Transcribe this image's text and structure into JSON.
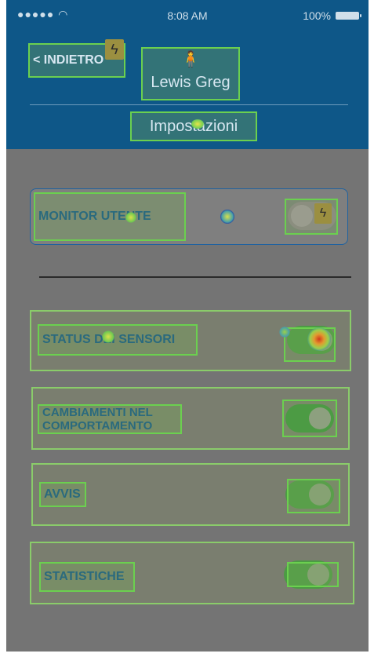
{
  "status_bar": {
    "signal": "●●●●● ",
    "wifi": "wifi-icon",
    "time": "8:08 AM",
    "battery": "100%"
  },
  "header": {
    "back_label": "< INDIETRO",
    "user_name": "Lewis Greg",
    "title": "Impostazioni"
  },
  "monitor": {
    "label": "MONITOR UTENTE",
    "enabled": false
  },
  "settings": [
    {
      "label": "STATUS DEI SENSORI",
      "enabled": true
    },
    {
      "label": "CAMBIAMENTI NEL COMPORTAMENTO",
      "enabled": true
    },
    {
      "label": "AVVIS",
      "enabled": true
    },
    {
      "label": "STATISTICHE",
      "enabled": true
    }
  ],
  "colors": {
    "header_bg": "#0e5788",
    "page_bg": "#747474",
    "highlight": "#6bd04f"
  }
}
